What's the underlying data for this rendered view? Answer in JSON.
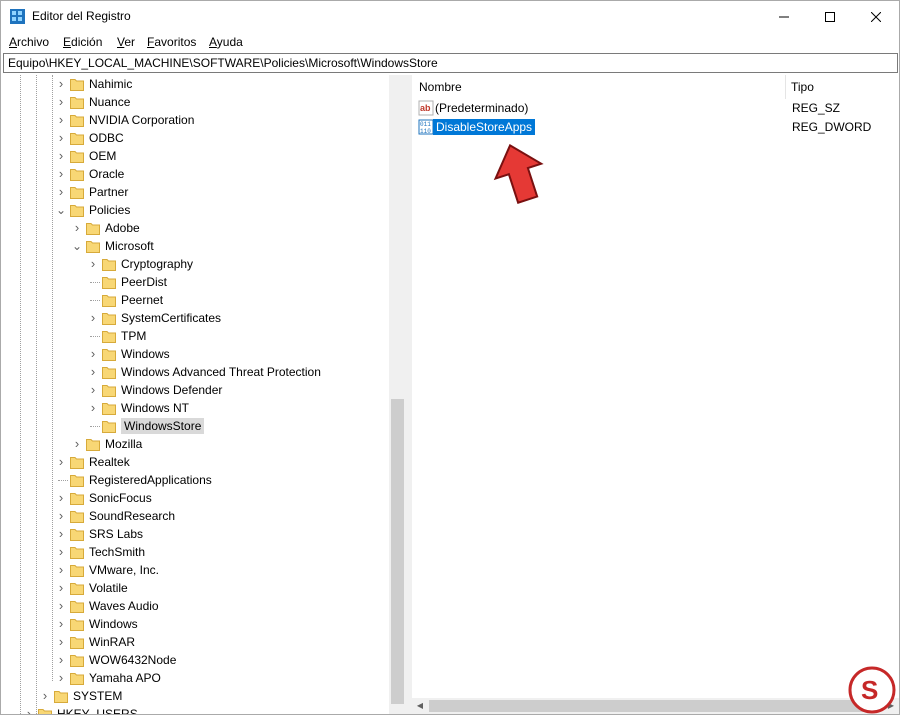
{
  "window": {
    "title": "Editor del Registro"
  },
  "menu": [
    {
      "acc": "A",
      "rest": "rchivo"
    },
    {
      "acc": "E",
      "rest": "dición"
    },
    {
      "acc": "V",
      "rest": "er"
    },
    {
      "acc": "F",
      "rest": "avoritos"
    },
    {
      "acc": "A",
      "rest": "yuda"
    }
  ],
  "address": {
    "path": "Equipo\\HKEY_LOCAL_MACHINE\\SOFTWARE\\Policies\\Microsoft\\WindowsStore"
  },
  "tree": [
    {
      "label": "Nahimic",
      "depth": 0,
      "chevron": "collapsed"
    },
    {
      "label": "Nuance",
      "depth": 0,
      "chevron": "collapsed"
    },
    {
      "label": "NVIDIA Corporation",
      "depth": 0,
      "chevron": "collapsed"
    },
    {
      "label": "ODBC",
      "depth": 0,
      "chevron": "collapsed"
    },
    {
      "label": "OEM",
      "depth": 0,
      "chevron": "collapsed"
    },
    {
      "label": "Oracle",
      "depth": 0,
      "chevron": "collapsed"
    },
    {
      "label": "Partner",
      "depth": 0,
      "chevron": "collapsed"
    },
    {
      "label": "Policies",
      "depth": 0,
      "chevron": "expanded"
    },
    {
      "label": "Adobe",
      "depth": 1,
      "chevron": "collapsed"
    },
    {
      "label": "Microsoft",
      "depth": 1,
      "chevron": "expanded"
    },
    {
      "label": "Cryptography",
      "depth": 2,
      "chevron": "collapsed"
    },
    {
      "label": "PeerDist",
      "depth": 2,
      "chevron": "none"
    },
    {
      "label": "Peernet",
      "depth": 2,
      "chevron": "none"
    },
    {
      "label": "SystemCertificates",
      "depth": 2,
      "chevron": "collapsed"
    },
    {
      "label": "TPM",
      "depth": 2,
      "chevron": "none"
    },
    {
      "label": "Windows",
      "depth": 2,
      "chevron": "collapsed"
    },
    {
      "label": "Windows Advanced Threat Protection",
      "depth": 2,
      "chevron": "collapsed"
    },
    {
      "label": "Windows Defender",
      "depth": 2,
      "chevron": "collapsed"
    },
    {
      "label": "Windows NT",
      "depth": 2,
      "chevron": "collapsed"
    },
    {
      "label": "WindowsStore",
      "depth": 2,
      "chevron": "none",
      "selected": true
    },
    {
      "label": "Mozilla",
      "depth": 1,
      "chevron": "collapsed"
    },
    {
      "label": "Realtek",
      "depth": 0,
      "chevron": "collapsed"
    },
    {
      "label": "RegisteredApplications",
      "depth": 0,
      "chevron": "none"
    },
    {
      "label": "SonicFocus",
      "depth": 0,
      "chevron": "collapsed"
    },
    {
      "label": "SoundResearch",
      "depth": 0,
      "chevron": "collapsed"
    },
    {
      "label": "SRS Labs",
      "depth": 0,
      "chevron": "collapsed"
    },
    {
      "label": "TechSmith",
      "depth": 0,
      "chevron": "collapsed"
    },
    {
      "label": "VMware, Inc.",
      "depth": 0,
      "chevron": "collapsed"
    },
    {
      "label": "Volatile",
      "depth": 0,
      "chevron": "collapsed"
    },
    {
      "label": "Waves Audio",
      "depth": 0,
      "chevron": "collapsed"
    },
    {
      "label": "Windows",
      "depth": 0,
      "chevron": "collapsed"
    },
    {
      "label": "WinRAR",
      "depth": 0,
      "chevron": "collapsed"
    },
    {
      "label": "WOW6432Node",
      "depth": 0,
      "chevron": "collapsed"
    },
    {
      "label": "Yamaha APO",
      "depth": 0,
      "chevron": "collapsed"
    },
    {
      "label": "SYSTEM",
      "depth": -1,
      "chevron": "collapsed"
    },
    {
      "label": "HKEY_USERS",
      "depth": -2,
      "chevron": "collapsed"
    }
  ],
  "list": {
    "headers": {
      "name": "Nombre",
      "type": "Tipo"
    },
    "rows": [
      {
        "name": "(Predeterminado)",
        "type": "REG_SZ",
        "icon": "string-value-icon",
        "selected": false
      },
      {
        "name": "DisableStoreApps",
        "type": "REG_DWORD",
        "icon": "binary-value-icon",
        "selected": true
      }
    ]
  }
}
